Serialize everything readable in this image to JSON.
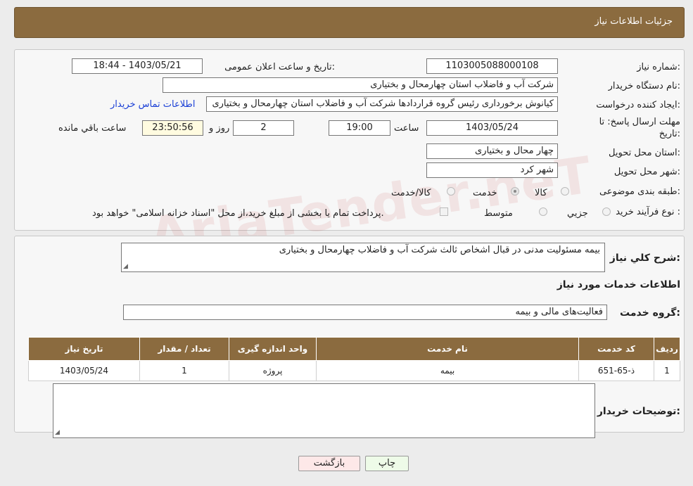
{
  "header": {
    "title": "جزئیات اطلاعات نیاز"
  },
  "watermark": "AriaTender.neT",
  "form": {
    "need_number_label": "شماره نیاز:",
    "need_number": "1103005088000108",
    "announce_label": "تاریخ و ساعت اعلان عمومی:",
    "announce_value": "1403/05/21 - 18:44",
    "buyer_org_label": "نام دستگاه خریدار:",
    "buyer_org": "شرکت آب و فاضلاب استان چهارمحال و بختیاری",
    "creator_label": "ایجاد کننده درخواست:",
    "creator": "کیانوش برخورداری رئیس گروه قراردادها شرکت آب و فاضلاب استان چهارمحال و بختیاری",
    "contact_link": "اطلاعات تماس خریدار",
    "deadline_label_1": "مهلت ارسال پاسخ: تا",
    "deadline_label_2": "تاریخ:",
    "deadline_date": "1403/05/24",
    "time_label": "ساعت",
    "deadline_time": "19:00",
    "days_value": "2",
    "days_label": "روز و",
    "remaining_value": "23:50:56",
    "remaining_label": "ساعت باقي مانده",
    "province_label": "استان محل تحویل:",
    "province": "چهار محال و بختیاری",
    "city_label": "شهر محل تحویل:",
    "city": "شهر کرد",
    "category_label": "طبقه بندی موضوعی:",
    "category_options": [
      "کالا",
      "خدمت",
      "کالا/خدمت"
    ],
    "category_selected": "خدمت",
    "process_label": "نوع فرآیند خرید :",
    "process_options": [
      "جزیي",
      "متوسط"
    ],
    "payment_note": "پرداخت تمام یا بخشی از مبلغ خرید،از محل \"اسناد خزانه اسلامی\" خواهد بود."
  },
  "details": {
    "summary_label": "شرح کلي نياز:",
    "summary": "بیمه مسئولیت مدنی در قبال اشخاص ثالث شرکت آب و فاضلاب چهارمحال و بختیاری",
    "services_title": "اطلاعات خدمات مورد نياز",
    "service_group_label": "گروه خدمت:",
    "service_group": "فعالیت‌های مالی و بیمه",
    "table": {
      "headers": [
        "رديف",
        "کد خدمت",
        "نام خدمت",
        "واحد اندازه گيری",
        "تعداد / مقدار",
        "تاريخ نياز"
      ],
      "rows": [
        [
          "1",
          "ذ-65-651",
          "بیمه",
          "پروژه",
          "1",
          "1403/05/24"
        ]
      ]
    },
    "buyer_notes_label": "توضيحات خريدار:",
    "buyer_notes": ""
  },
  "buttons": {
    "print": "چاپ",
    "back": "بازگشت"
  }
}
